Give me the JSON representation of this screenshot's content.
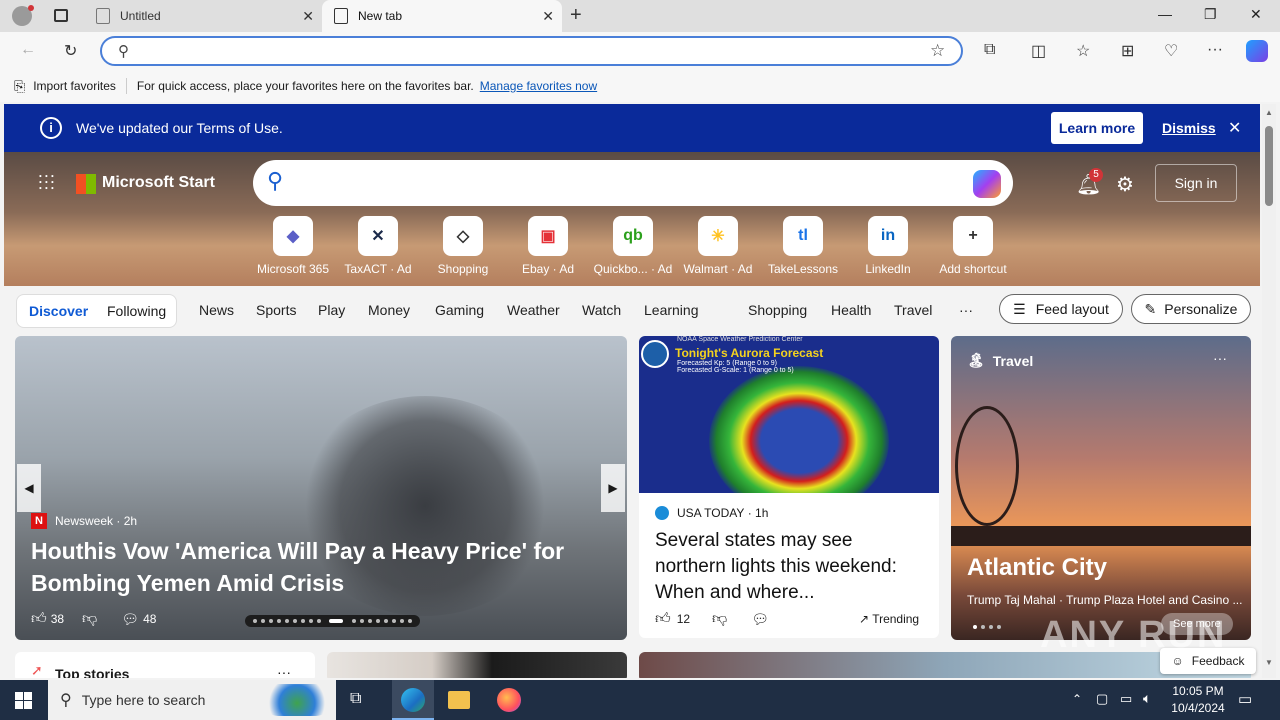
{
  "browser": {
    "tabs": [
      {
        "label": "Untitled"
      },
      {
        "label": "New tab"
      }
    ],
    "favorites_bar": {
      "import_label": "Import favorites",
      "hint": "For quick access, place your favorites here on the favorites bar.",
      "manage_link": "Manage favorites now"
    }
  },
  "banner": {
    "text": "We've updated our Terms of Use.",
    "learn_more": "Learn more",
    "dismiss": "Dismiss"
  },
  "header": {
    "brand": "Microsoft Start",
    "notifications_count": "5",
    "sign_in": "Sign in"
  },
  "shortcuts": [
    {
      "label": "Microsoft 365",
      "icon": "m365-icon",
      "glyph": "◆",
      "color": "#5b5fc7"
    },
    {
      "label": "TaxACT · Ad",
      "icon": "taxact-icon",
      "glyph": "✕",
      "color": "#1b2a4a"
    },
    {
      "label": "Shopping",
      "icon": "tag-icon",
      "glyph": "◇",
      "color": "#333333"
    },
    {
      "label": "Ebay · Ad",
      "icon": "ebay-icon",
      "glyph": "▣",
      "color": "#e53238"
    },
    {
      "label": "Quickbo... · Ad",
      "icon": "quickbooks-icon",
      "glyph": "qb",
      "color": "#2ca01c"
    },
    {
      "label": "Walmart · Ad",
      "icon": "walmart-icon",
      "glyph": "✳",
      "color": "#ffc220"
    },
    {
      "label": "TakeLessons",
      "icon": "takelessons-icon",
      "glyph": "tl",
      "color": "#1a73e8"
    },
    {
      "label": "LinkedIn",
      "icon": "linkedin-icon",
      "glyph": "in",
      "color": "#0a66c2"
    },
    {
      "label": "Add shortcut",
      "icon": "plus-icon",
      "glyph": "+",
      "color": "#333333"
    }
  ],
  "nav": {
    "discover": "Discover",
    "following": "Following",
    "items": [
      "News",
      "Sports",
      "Play",
      "Money",
      "Gaming",
      "Weather",
      "Watch",
      "Learning",
      "Shopping",
      "Health",
      "Travel"
    ],
    "more": "···",
    "feed_layout": "Feed layout",
    "personalize": "Personalize"
  },
  "hero_card": {
    "source": "Newsweek",
    "age": "2h",
    "headline": "Houthis Vow 'America Will Pay a Heavy Price' for Bombing Yemen Amid Crisis",
    "likes": "38",
    "comments": "48"
  },
  "aurora_card": {
    "image_title": "Tonight's Aurora Forecast",
    "image_caption": "NOAA Space Weather Prediction Center",
    "image_line1": "Forecasted Kp: 5 (Range 0 to 9)",
    "image_line2": "Forecasted G-Scale: 1 (Range 0 to 5)",
    "source": "USA TODAY",
    "age": "1h",
    "headline": "Several states may see northern lights this weekend: When and where...",
    "likes": "12",
    "trending": "Trending"
  },
  "travel_card": {
    "label": "Travel",
    "title": "Atlantic City",
    "subtitle": "Trump Taj Mahal · Trump Plaza Hotel and Casino ...",
    "see_more": "See more"
  },
  "bottom": {
    "top_stories": "Top stories",
    "feedback": "Feedback"
  },
  "taskbar": {
    "search_placeholder": "Type here to search",
    "time": "10:05 PM",
    "date": "10/4/2024"
  },
  "watermark": "ANY RUN"
}
